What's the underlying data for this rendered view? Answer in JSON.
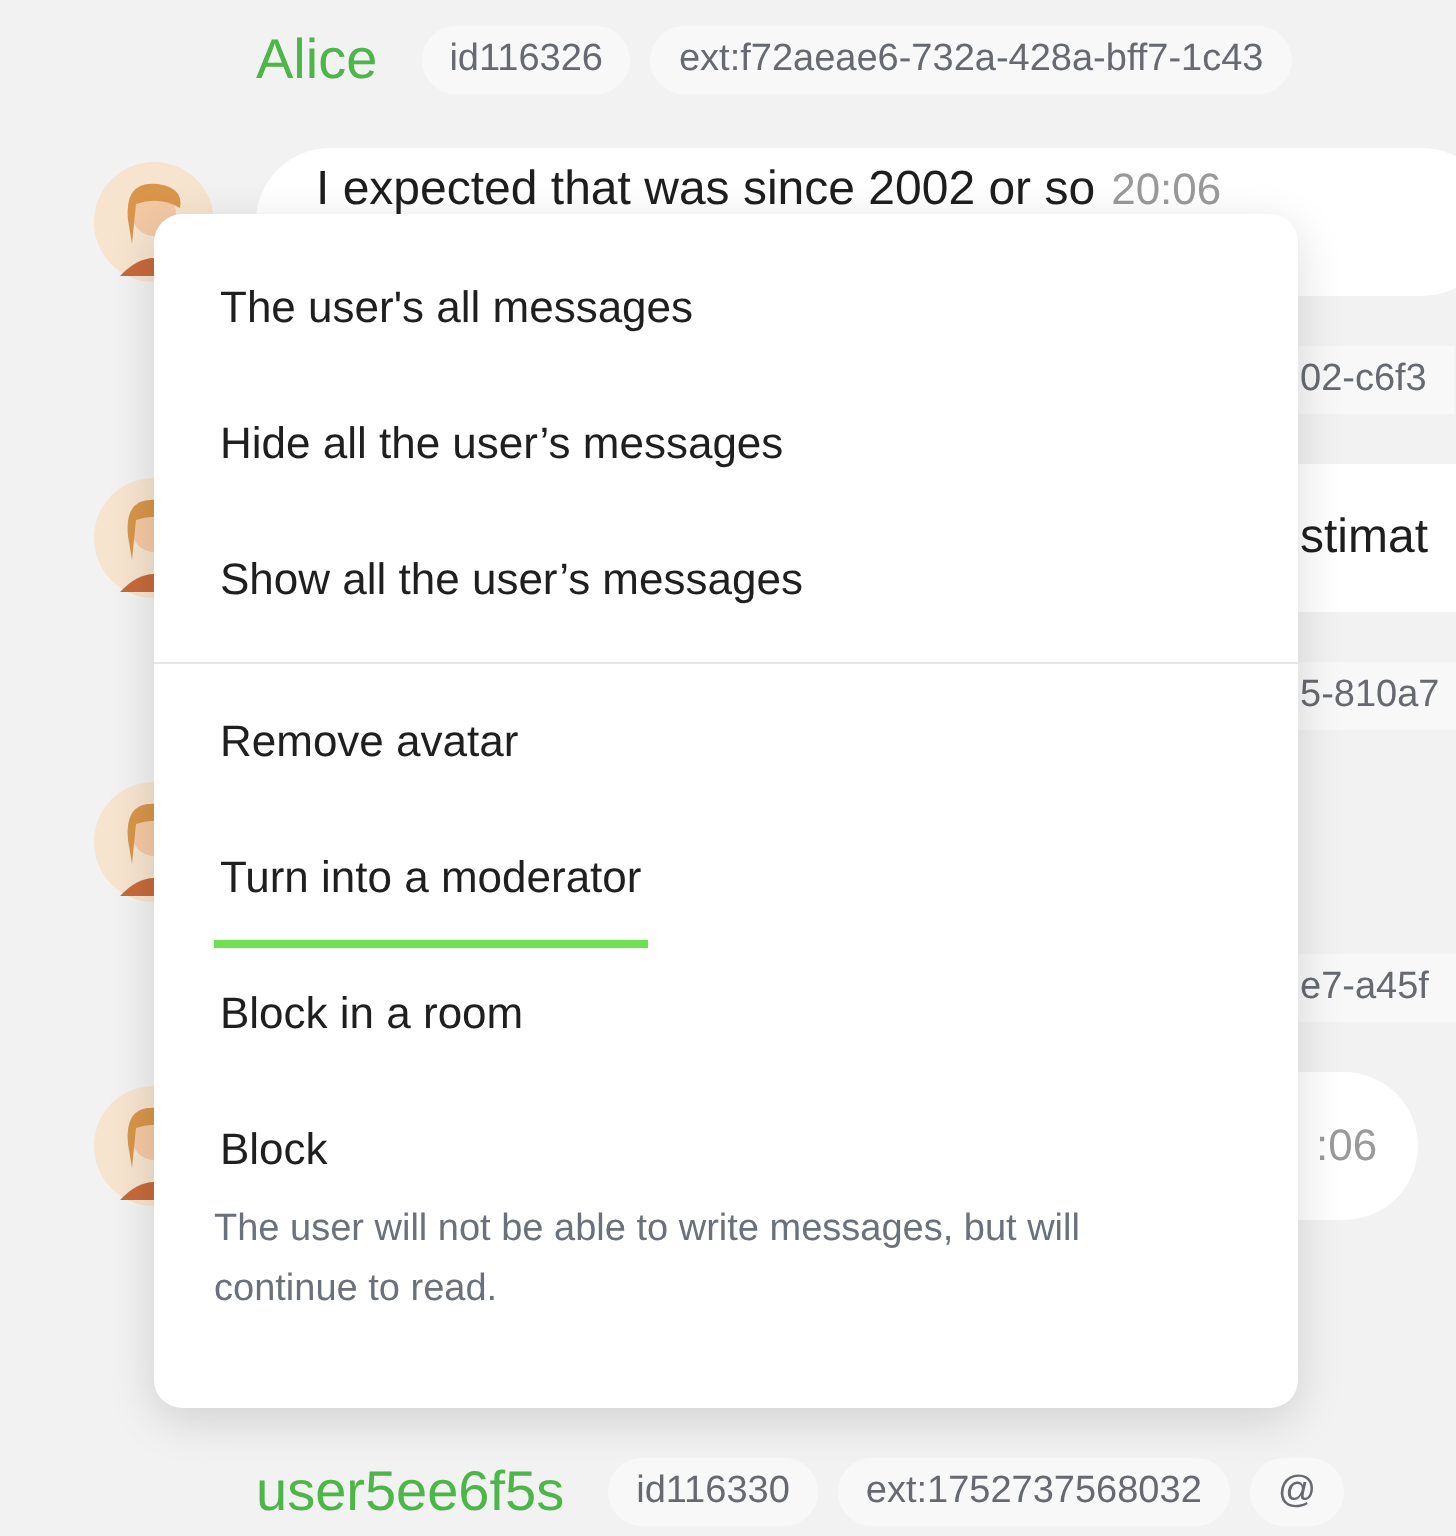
{
  "chat": [
    {
      "kind": "header",
      "name": "Alice",
      "tags": [
        "id116326",
        "ext:f72aeae6-732a-428a-bff7-1c43"
      ]
    },
    {
      "kind": "message",
      "text": "I expected that was since 2002 or so",
      "time": "20:06"
    },
    {
      "kind": "tags_fragment",
      "tags": [
        "02-c6f3"
      ]
    },
    {
      "kind": "message_fragment",
      "text": "stimat"
    },
    {
      "kind": "tags_fragment",
      "tags": [
        "5-810a7"
      ]
    },
    {
      "kind": "avatar"
    },
    {
      "kind": "tags_fragment",
      "tags": [
        "e7-a45f"
      ]
    },
    {
      "kind": "message_fragment",
      "time": ":06"
    },
    {
      "kind": "header",
      "name": "user5ee6f5s",
      "tags": [
        "id116330",
        "ext:1752737568032",
        "@"
      ]
    }
  ],
  "context_menu": {
    "groups": [
      [
        {
          "label": "The user's all messages",
          "selected": false
        },
        {
          "label": "Hide all the user’s messages",
          "selected": false
        },
        {
          "label": "Show all the user’s messages",
          "selected": false
        }
      ],
      [
        {
          "label": "Remove avatar",
          "selected": false
        },
        {
          "label": "Turn into a moderator",
          "selected": true
        },
        {
          "label": "Block in a room",
          "selected": false
        },
        {
          "label": "Block",
          "selected": false,
          "description": "The user will not be able to write messages, but will continue to read."
        }
      ]
    ]
  }
}
